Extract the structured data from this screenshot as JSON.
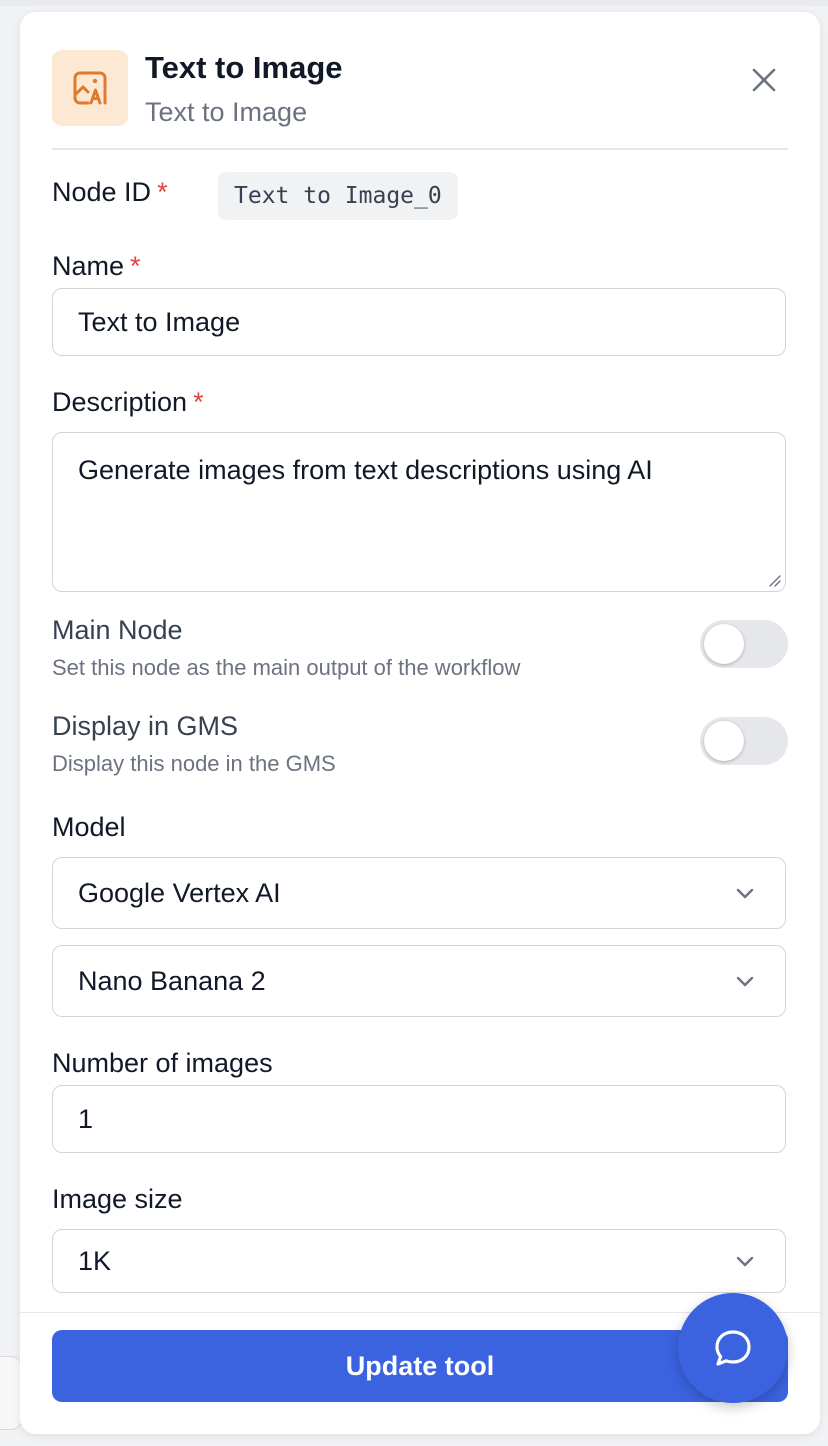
{
  "colors": {
    "accent": "#3b63e0",
    "required": "#e0443c",
    "icon_bg": "#fde9d3",
    "icon_fg": "#e07a2e"
  },
  "header": {
    "title": "Text to Image",
    "subtitle": "Text to Image",
    "icon": "image-ai-icon",
    "close_icon": "close-icon"
  },
  "node_id": {
    "label": "Node ID",
    "required_mark": "*",
    "value": "Text to Image_0"
  },
  "name": {
    "label": "Name",
    "required_mark": "*",
    "value": "Text to Image"
  },
  "description": {
    "label": "Description",
    "required_mark": "*",
    "value": "Generate images from text descriptions using AI"
  },
  "main_node": {
    "title": "Main Node",
    "description": "Set this node as the main output of the workflow",
    "enabled": false
  },
  "display_in_gms": {
    "title": "Display in GMS",
    "description": "Display this node in the GMS",
    "enabled": false
  },
  "model": {
    "label": "Model",
    "provider": "Google Vertex AI",
    "model_name": "Nano Banana 2"
  },
  "number_of_images": {
    "label": "Number of images",
    "value": "1"
  },
  "image_size": {
    "label": "Image size",
    "value": "1K"
  },
  "footer": {
    "update_label": "Update tool",
    "chat_icon": "chat-bubble-icon"
  }
}
